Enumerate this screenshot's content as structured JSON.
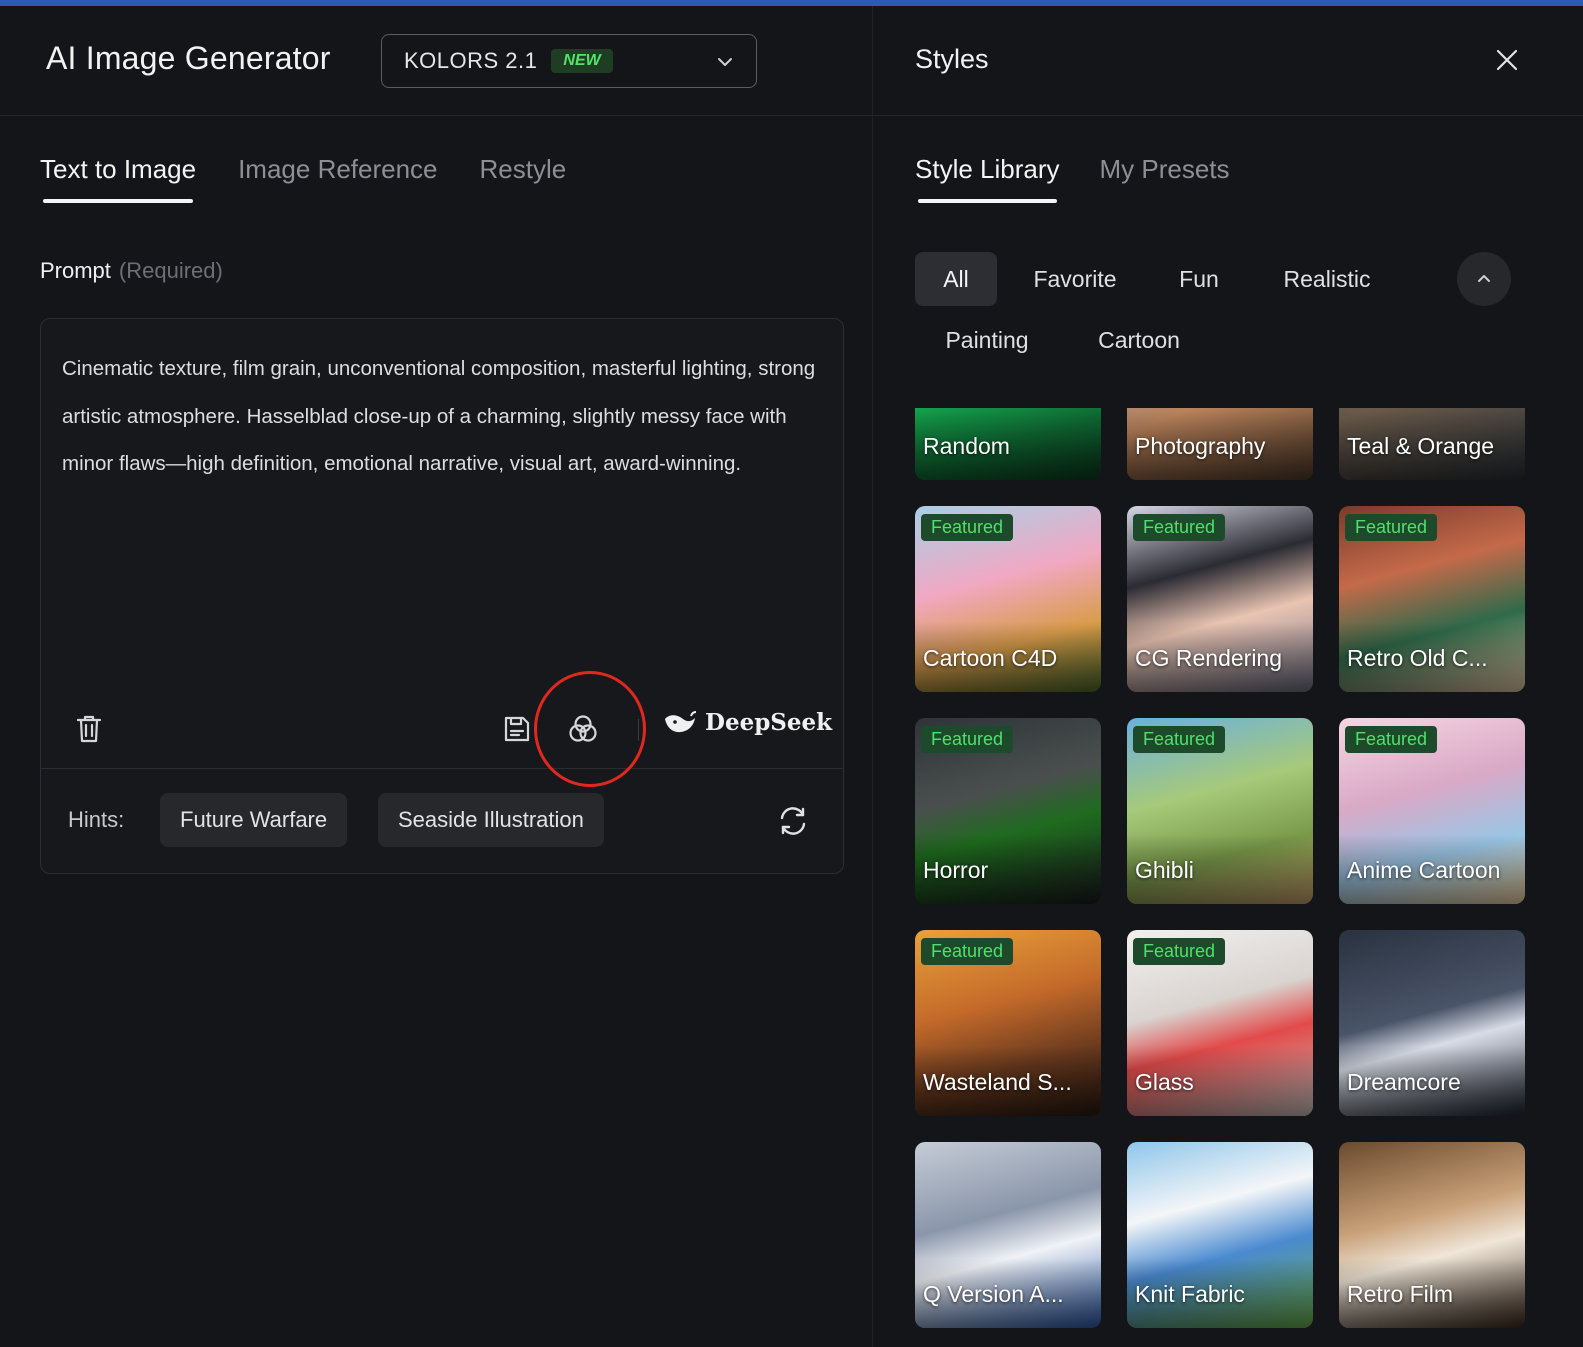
{
  "app": {
    "title": "AI Image Generator",
    "model": {
      "name": "KOLORS 2.1",
      "badge": "NEW"
    }
  },
  "tabs": [
    {
      "label": "Text to Image",
      "active": true
    },
    {
      "label": "Image Reference",
      "active": false
    },
    {
      "label": "Restyle",
      "active": false
    }
  ],
  "prompt": {
    "label": "Prompt",
    "required": "(Required)",
    "value": "Cinematic texture, film grain, unconventional composition, masterful lighting, strong artistic atmosphere. Hasselblad close-up of a charming, slightly messy face with minor flaws—high definition, emotional narrative, visual art, award-winning.",
    "deepseek_label": "DeepSeek"
  },
  "hints": {
    "label": "Hints:",
    "items": [
      "Future Warfare",
      "Seaside Illustration"
    ]
  },
  "styles": {
    "title": "Styles",
    "tabs": [
      {
        "label": "Style Library",
        "active": true
      },
      {
        "label": "My Presets",
        "active": false
      }
    ],
    "filters": [
      "All",
      "Favorite",
      "Fun",
      "Realistic",
      "Painting",
      "Cartoon"
    ],
    "active_filter": "All",
    "featured_label": "Featured",
    "cards": [
      {
        "label": "Random",
        "featured": false
      },
      {
        "label": "Photography",
        "featured": false
      },
      {
        "label": "Teal & Orange",
        "featured": false
      },
      {
        "label": "Cartoon C4D",
        "featured": true
      },
      {
        "label": "CG Rendering",
        "featured": true
      },
      {
        "label": "Retro Old C...",
        "featured": true
      },
      {
        "label": "Horror",
        "featured": true
      },
      {
        "label": "Ghibli",
        "featured": true
      },
      {
        "label": "Anime Cartoon",
        "featured": true
      },
      {
        "label": "Wasteland S...",
        "featured": true
      },
      {
        "label": "Glass",
        "featured": true
      },
      {
        "label": "Dreamcore",
        "featured": false
      },
      {
        "label": "Q Version A...",
        "featured": false
      },
      {
        "label": "Knit Fabric",
        "featured": false
      },
      {
        "label": "Retro Film",
        "featured": false
      }
    ]
  },
  "colors": {
    "background": "#141518",
    "accent_green": "#4fe06b",
    "highlight_ring": "#e0281f"
  }
}
